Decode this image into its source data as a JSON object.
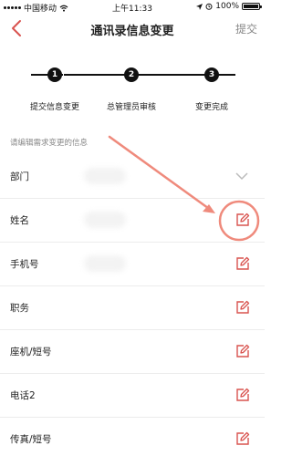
{
  "status_bar": {
    "carrier": "中国移动",
    "time": "上午11:33",
    "battery": "100%",
    "battery_level": 1.0
  },
  "nav": {
    "title": "通讯录信息变更",
    "submit_label": "提交",
    "back_icon": "chevron-left-icon"
  },
  "steps": [
    {
      "number": "1",
      "label": "提交信息变更"
    },
    {
      "number": "2",
      "label": "总管理员审核"
    },
    {
      "number": "3",
      "label": "变更完成"
    }
  ],
  "hint": "请编辑需求变更的信息",
  "fields": [
    {
      "label": "部门",
      "action_icon": "chevron-down-icon"
    },
    {
      "label": "姓名",
      "action_icon": "edit-icon"
    },
    {
      "label": "手机号",
      "action_icon": "edit-icon"
    },
    {
      "label": "职务",
      "action_icon": "edit-icon"
    },
    {
      "label": "座机/短号",
      "action_icon": "edit-icon"
    },
    {
      "label": "电话2",
      "action_icon": "edit-icon"
    },
    {
      "label": "传真/短号",
      "action_icon": "edit-icon"
    }
  ],
  "colors": {
    "accent": "#d9534f",
    "annotation": "#ef8a7c",
    "step": "#111111",
    "hint": "#888888"
  }
}
